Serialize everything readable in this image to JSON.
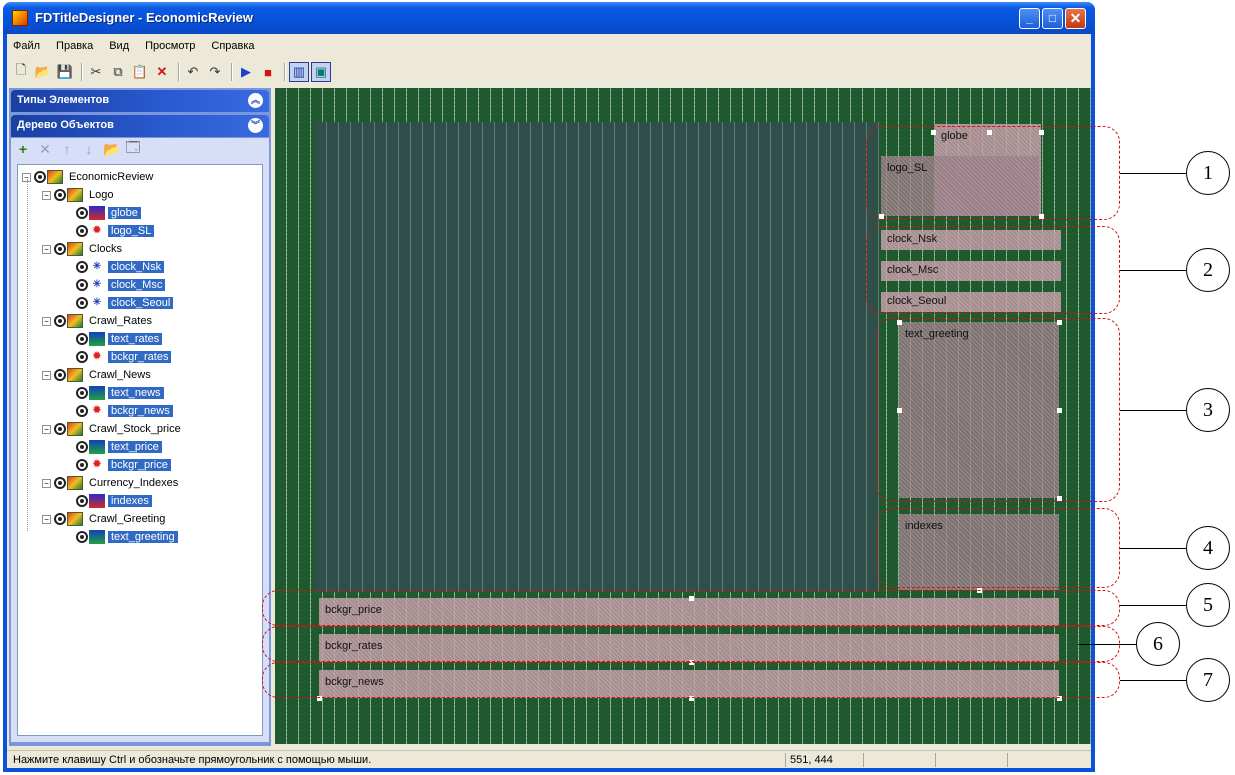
{
  "window": {
    "title": "FDTitleDesigner - EconomicReview",
    "min_glyph": "_",
    "max_glyph": "□",
    "close_glyph": "✕"
  },
  "menu": [
    "Файл",
    "Правка",
    "Вид",
    "Просмотр",
    "Справка"
  ],
  "toolbar": {
    "icons": [
      "new-icon",
      "open-icon",
      "save-icon",
      "cut-icon",
      "copy-icon",
      "paste-icon",
      "delete-icon",
      "undo-icon",
      "redo-icon",
      "play-icon",
      "stop-icon",
      "grid-icon",
      "safe-area-icon"
    ]
  },
  "left_panel": {
    "section1_title": "Типы Элементов",
    "section2_title": "Дерево Объектов",
    "chevron_up": "︽",
    "chevron_down": "︾",
    "tree": {
      "root": "EconomicReview",
      "groups": [
        {
          "name": "Logo",
          "items": [
            {
              "name": "globe",
              "icon": "video"
            },
            {
              "name": "logo_SL",
              "icon": "image"
            }
          ]
        },
        {
          "name": "Clocks",
          "items": [
            {
              "name": "clock_Nsk",
              "icon": "clock"
            },
            {
              "name": "clock_Msc",
              "icon": "clock"
            },
            {
              "name": "clock_Seoul",
              "icon": "clock"
            }
          ]
        },
        {
          "name": "Crawl_Rates",
          "items": [
            {
              "name": "text_rates",
              "icon": "text"
            },
            {
              "name": "bckgr_rates",
              "icon": "image"
            }
          ]
        },
        {
          "name": "Crawl_News",
          "items": [
            {
              "name": "text_news",
              "icon": "text"
            },
            {
              "name": "bckgr_news",
              "icon": "image"
            }
          ]
        },
        {
          "name": "Crawl_Stock_price",
          "items": [
            {
              "name": "text_price",
              "icon": "text"
            },
            {
              "name": "bckgr_price",
              "icon": "image"
            }
          ]
        },
        {
          "name": "Currency_Indexes",
          "items": [
            {
              "name": "indexes",
              "icon": "video"
            }
          ]
        },
        {
          "name": "Crawl_Greeting",
          "items": [
            {
              "name": "text_greeting",
              "icon": "text"
            }
          ]
        }
      ]
    }
  },
  "canvas": {
    "objects": {
      "globe": "globe",
      "logo_sl": "logo_SL",
      "clock_nsk": "clock_Nsk",
      "clock_msc": "clock_Msc",
      "clock_seoul": "clock_Seoul",
      "text_greeting": "text_greeting",
      "indexes": "indexes",
      "bckgr_price": "bckgr_price",
      "bckgr_rates": "bckgr_rates",
      "bckgr_news": "bckgr_news"
    },
    "colors": {
      "background": "#1e5a2e",
      "safe_area": "#2f4f4a",
      "object": "#be96a0",
      "callout": "#d81010"
    }
  },
  "status": {
    "message": "Нажмите клавишу Ctrl и обозначьте прямоугольник с помощью мыши.",
    "coords": "551, 444"
  },
  "annotations": [
    "1",
    "2",
    "3",
    "4",
    "5",
    "6",
    "7"
  ]
}
